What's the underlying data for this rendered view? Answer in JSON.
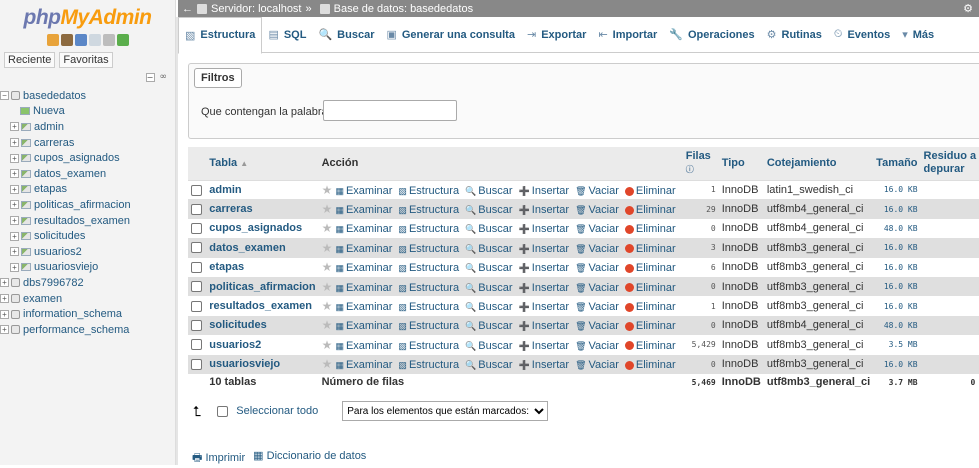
{
  "app": {
    "logo_php": "php",
    "logo_myadmin": "MyAdmin"
  },
  "nav_tabs": [
    "Reciente",
    "Favoritas"
  ],
  "tree": {
    "current_db": "basededatos",
    "new_label": "Nueva",
    "tables": [
      "admin",
      "carreras",
      "cupos_asignados",
      "datos_examen",
      "etapas",
      "politicas_afirmacion",
      "resultados_examen",
      "solicitudes",
      "usuarios2",
      "usuariosviejo"
    ],
    "other_dbs": [
      "dbs7996782",
      "examen",
      "information_schema",
      "performance_schema"
    ]
  },
  "breadcrumb": {
    "server": "Servidor: localhost",
    "sep": "»",
    "db": "Base de datos: basededatos"
  },
  "menu": [
    "Estructura",
    "SQL",
    "Buscar",
    "Generar una consulta",
    "Exportar",
    "Importar",
    "Operaciones",
    "Rutinas",
    "Eventos",
    "Más"
  ],
  "filters": {
    "legend": "Filtros",
    "label": "Que contengan la palabra:",
    "value": ""
  },
  "table_headers": {
    "tabla": "Tabla",
    "accion": "Acción",
    "filas": "Filas",
    "tipo": "Tipo",
    "cotejamiento": "Cotejamiento",
    "tamano": "Tamaño",
    "residuo": "Residuo a depurar"
  },
  "actions": [
    "Examinar",
    "Estructura",
    "Buscar",
    "Insertar",
    "Vaciar",
    "Eliminar"
  ],
  "rows": [
    {
      "name": "admin",
      "rows": "1",
      "type": "InnoDB",
      "collation": "latin1_swedish_ci",
      "size": "16.0 KB",
      "overhead": "-"
    },
    {
      "name": "carreras",
      "rows": "29",
      "type": "InnoDB",
      "collation": "utf8mb4_general_ci",
      "size": "16.0 KB",
      "overhead": "-"
    },
    {
      "name": "cupos_asignados",
      "rows": "0",
      "type": "InnoDB",
      "collation": "utf8mb4_general_ci",
      "size": "48.0 KB",
      "overhead": "-"
    },
    {
      "name": "datos_examen",
      "rows": "3",
      "type": "InnoDB",
      "collation": "utf8mb3_general_ci",
      "size": "16.0 KB",
      "overhead": "-"
    },
    {
      "name": "etapas",
      "rows": "6",
      "type": "InnoDB",
      "collation": "utf8mb3_general_ci",
      "size": "16.0 KB",
      "overhead": "-"
    },
    {
      "name": "politicas_afirmacion",
      "rows": "0",
      "type": "InnoDB",
      "collation": "utf8mb3_general_ci",
      "size": "16.0 KB",
      "overhead": "-"
    },
    {
      "name": "resultados_examen",
      "rows": "1",
      "type": "InnoDB",
      "collation": "utf8mb3_general_ci",
      "size": "16.0 KB",
      "overhead": "-"
    },
    {
      "name": "solicitudes",
      "rows": "0",
      "type": "InnoDB",
      "collation": "utf8mb4_general_ci",
      "size": "48.0 KB",
      "overhead": "-"
    },
    {
      "name": "usuarios2",
      "rows": "5,429",
      "type": "InnoDB",
      "collation": "utf8mb3_general_ci",
      "size": "3.5 MB",
      "overhead": "-"
    },
    {
      "name": "usuariosviejo",
      "rows": "0",
      "type": "InnoDB",
      "collation": "utf8mb3_general_ci",
      "size": "16.0 KB",
      "overhead": "-"
    }
  ],
  "footer": {
    "count": "10 tablas",
    "label": "Número de filas",
    "rows": "5,469",
    "type": "InnoDB",
    "collation": "utf8mb3_general_ci",
    "size": "3.7 MB",
    "overhead": "0 B"
  },
  "bulk": {
    "select_all": "Seleccionar todo",
    "select_option": "Para los elementos que están marcados:"
  },
  "links": {
    "print": "Imprimir",
    "dict": "Diccionario de datos"
  }
}
